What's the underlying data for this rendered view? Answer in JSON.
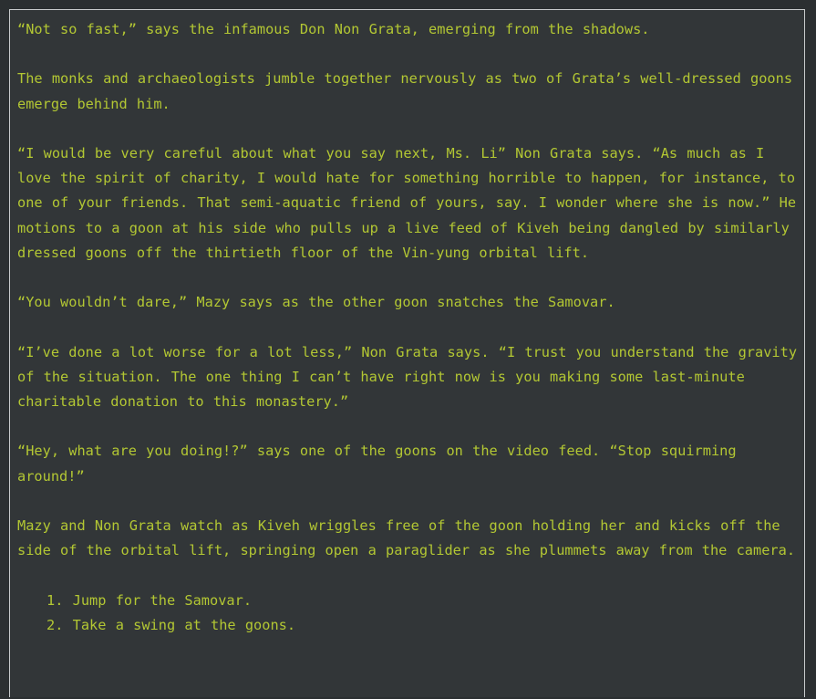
{
  "story": {
    "paragraphs": [
      "“Not so fast,” says the infamous Don Non Grata, emerging from the shadows.",
      "The monks and archaeologists jumble together nervously as two of Grata’s well-dressed goons emerge behind him.",
      "“I would be very careful about what you say next, Ms. Li” Non Grata says. “As much as I love the spirit of charity, I would hate for something horrible to happen, for instance, to one of your friends. That semi-aquatic friend of yours, say. I wonder where she is now.” He motions to a goon at his side who pulls up a live feed of Kiveh being dangled by similarly dressed goons off the thirtieth floor of the Vin-yung orbital lift.",
      "“You wouldn’t dare,” Mazy says as the other goon snatches the Samovar.",
      "“I’ve done a lot worse for a lot less,” Non Grata says. “I trust you understand the gravity of the situation. The one thing I can’t have right now is you making some last-minute charitable donation to this monastery.”",
      "“Hey, what are you doing!?” says one of the goons on the video feed. “Stop squirming around!”",
      "Mazy and Non Grata watch as Kiveh wriggles free of the goon holding her and kicks off the side of the orbital lift, springing open a paraglider as she plummets away from the camera."
    ],
    "choices": [
      {
        "number": "1.",
        "label": "Jump for the Samovar."
      },
      {
        "number": "2.",
        "label": "Take a swing at the goons."
      }
    ]
  },
  "colors": {
    "background": "#2b2f31",
    "panel": "#323638",
    "border": "#c9cccd",
    "text": "#b3c733"
  }
}
